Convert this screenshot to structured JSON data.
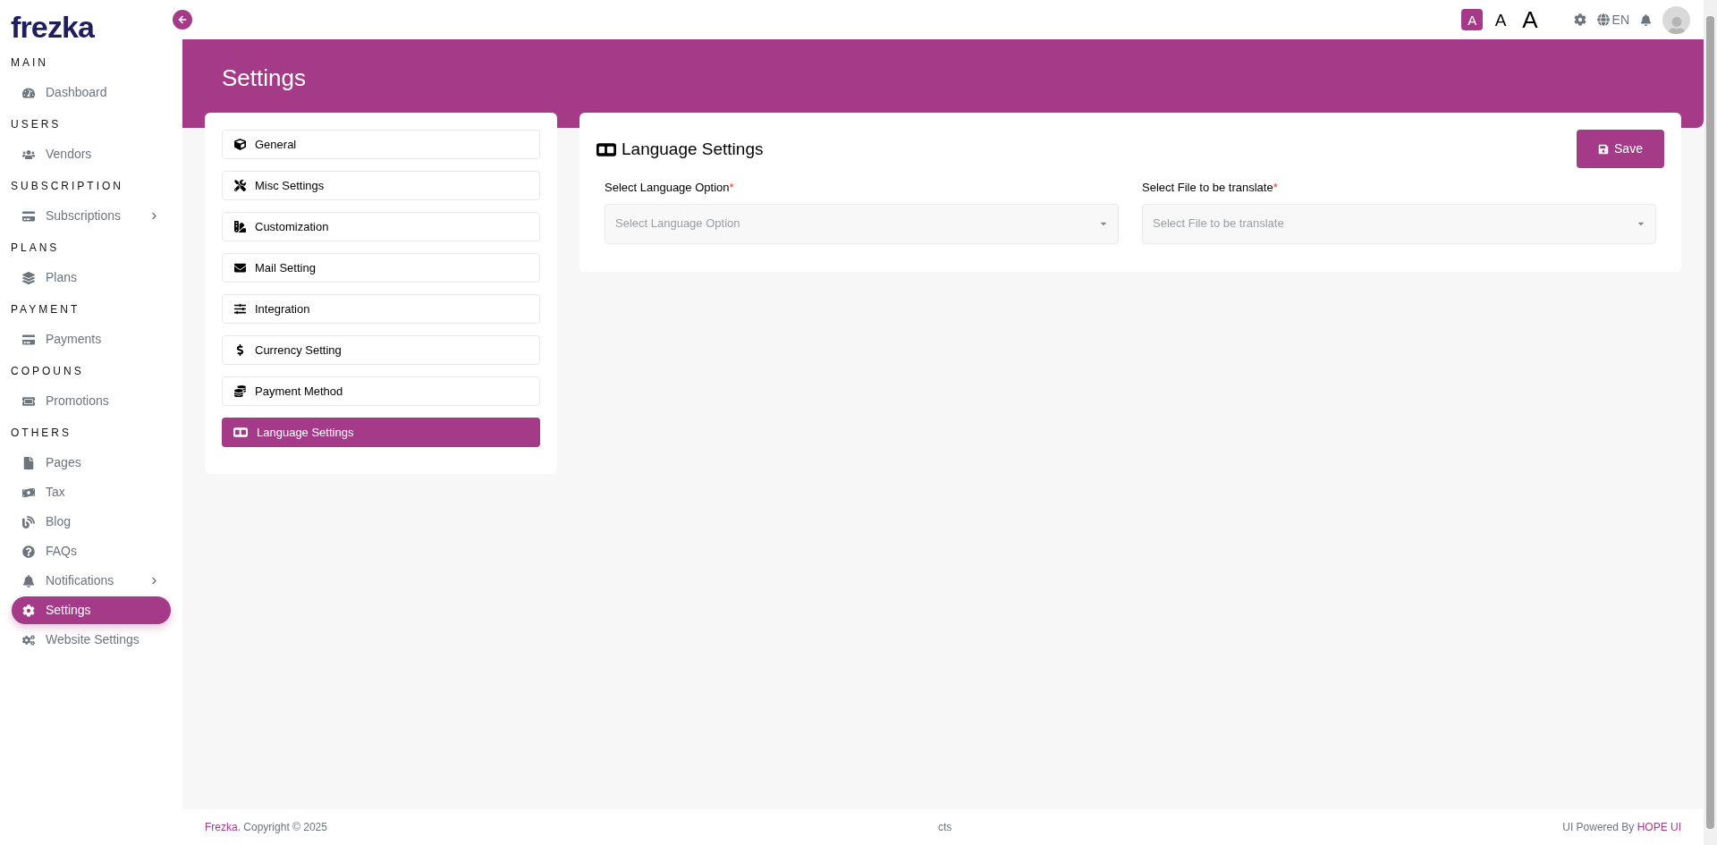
{
  "brand": "frezka",
  "sidebar": {
    "sections": [
      {
        "title": "MAIN",
        "items": [
          {
            "label": "Dashboard",
            "selected": false,
            "has_submenu": false
          }
        ]
      },
      {
        "title": "USERS",
        "items": [
          {
            "label": "Vendors",
            "selected": false,
            "has_submenu": false
          }
        ]
      },
      {
        "title": "SUBSCRIPTION",
        "items": [
          {
            "label": "Subscriptions",
            "selected": false,
            "has_submenu": true
          }
        ]
      },
      {
        "title": "PLANS",
        "items": [
          {
            "label": "Plans",
            "selected": false,
            "has_submenu": false
          }
        ]
      },
      {
        "title": "PAYMENT",
        "items": [
          {
            "label": "Payments",
            "selected": false,
            "has_submenu": false
          }
        ]
      },
      {
        "title": "COPOUNS",
        "items": [
          {
            "label": "Promotions",
            "selected": false,
            "has_submenu": false
          }
        ]
      },
      {
        "title": "OTHERS",
        "items": [
          {
            "label": "Pages",
            "selected": false,
            "has_submenu": false
          },
          {
            "label": "Tax",
            "selected": false,
            "has_submenu": false
          },
          {
            "label": "Blog",
            "selected": false,
            "has_submenu": false
          },
          {
            "label": "FAQs",
            "selected": false,
            "has_submenu": false
          },
          {
            "label": "Notifications",
            "selected": false,
            "has_submenu": true
          },
          {
            "label": "Settings",
            "selected": true,
            "has_submenu": false
          },
          {
            "label": "Website Settings",
            "selected": false,
            "has_submenu": false
          }
        ]
      }
    ]
  },
  "topbar": {
    "font_sizes": [
      {
        "label": "A",
        "selected": true
      },
      {
        "label": "A",
        "selected": false
      },
      {
        "label": "A",
        "selected": false
      }
    ],
    "language": "EN"
  },
  "page_title": "Settings",
  "settings_menu": [
    {
      "label": "General",
      "selected": false
    },
    {
      "label": "Misc Settings",
      "selected": false
    },
    {
      "label": "Customization",
      "selected": false
    },
    {
      "label": "Mail Setting",
      "selected": false
    },
    {
      "label": "Integration",
      "selected": false
    },
    {
      "label": "Currency Setting",
      "selected": false
    },
    {
      "label": "Payment Method",
      "selected": false
    },
    {
      "label": "Language Settings",
      "selected": true
    }
  ],
  "panel": {
    "title": "Language Settings",
    "save_button": "Save",
    "fields": [
      {
        "label": "Select Language Option",
        "required_mark": "*",
        "placeholder": "Select Language Option"
      },
      {
        "label": "Select File to be translate",
        "required_mark": "*",
        "placeholder": "Select File to be translate"
      }
    ]
  },
  "footer": {
    "brand": "Frezka",
    "copyright": ". Copyright © 2025",
    "center": "cts",
    "powered_by": "UI Powered By ",
    "powered_link": "HOPE UI"
  }
}
